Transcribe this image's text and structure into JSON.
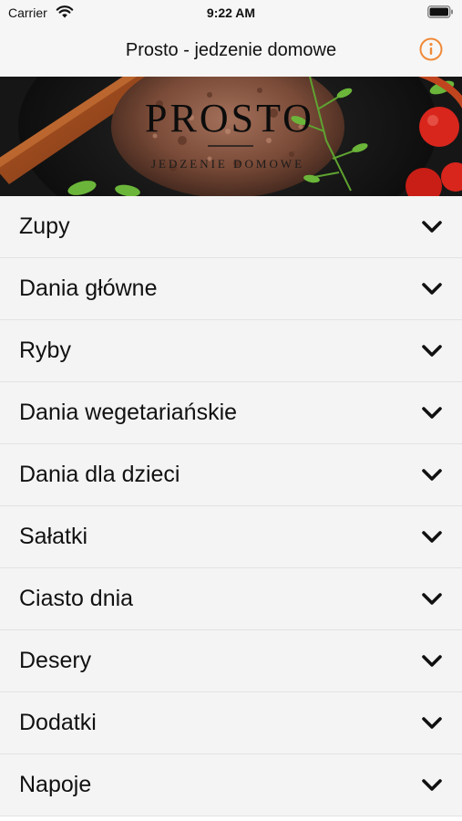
{
  "status_bar": {
    "carrier": "Carrier",
    "time": "9:22 AM",
    "wifi_icon": "wifi-icon",
    "battery_icon": "battery-full-icon"
  },
  "nav": {
    "title": "Prosto - jedzenie domowe",
    "info_icon": "info-circle-icon",
    "accent_color": "#f08a38"
  },
  "banner": {
    "logo_text": "PROSTO",
    "logo_subtitle": "JEDZENIE DOMOWE"
  },
  "categories": [
    {
      "label": "Zupy"
    },
    {
      "label": "Dania główne"
    },
    {
      "label": "Ryby"
    },
    {
      "label": "Dania wegetariańskie"
    },
    {
      "label": "Dania dla dzieci"
    },
    {
      "label": "Sałatki"
    },
    {
      "label": "Ciasto dnia"
    },
    {
      "label": "Desery"
    },
    {
      "label": "Dodatki"
    },
    {
      "label": "Napoje"
    }
  ],
  "list_icon": "chevron-down-icon"
}
